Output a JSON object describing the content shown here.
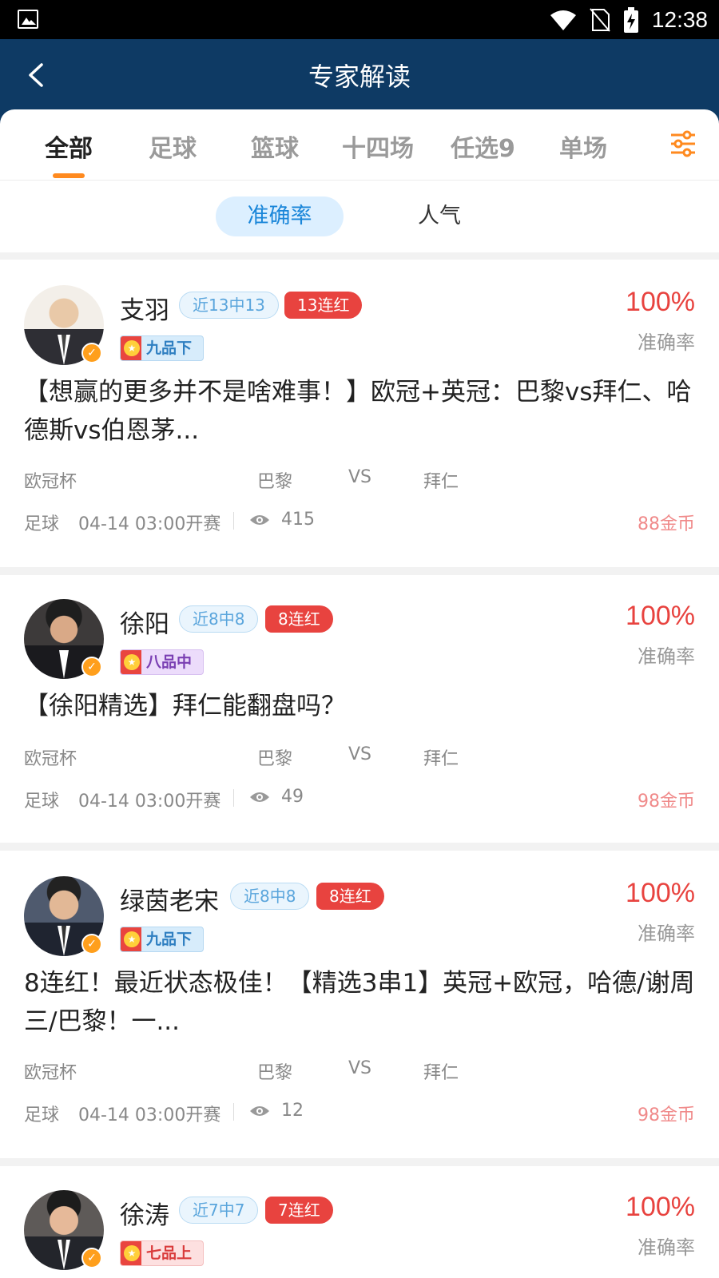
{
  "status_bar": {
    "time": "12:38"
  },
  "header": {
    "title": "专家解读"
  },
  "tabs": [
    {
      "label": "全部"
    },
    {
      "label": "足球"
    },
    {
      "label": "篮球"
    },
    {
      "label": "十四场"
    },
    {
      "label": "任选9"
    },
    {
      "label": "单场"
    }
  ],
  "subtabs": {
    "accuracy": "准确率",
    "popularity": "人气"
  },
  "cards": [
    {
      "name": "支羽",
      "recent": "近13中13",
      "streak": "13连红",
      "rank": "九品下",
      "accuracy": "100%",
      "accuracy_label": "准确率",
      "headline": "【想赢的更多并不是啥难事！】欧冠+英冠：巴黎vs拜仁、哈德斯vs伯恩茅...",
      "league": "欧冠杯",
      "home": "巴黎",
      "vs": "VS",
      "away": "拜仁",
      "sport": "足球",
      "kickoff": "04-14 03:00开赛",
      "views": "415",
      "price": "88金币"
    },
    {
      "name": "徐阳",
      "recent": "近8中8",
      "streak": "8连红",
      "rank": "八品中",
      "accuracy": "100%",
      "accuracy_label": "准确率",
      "headline": "【徐阳精选】拜仁能翻盘吗？",
      "league": "欧冠杯",
      "home": "巴黎",
      "vs": "VS",
      "away": "拜仁",
      "sport": "足球",
      "kickoff": "04-14 03:00开赛",
      "views": "49",
      "price": "98金币"
    },
    {
      "name": "绿茵老宋",
      "recent": "近8中8",
      "streak": "8连红",
      "rank": "九品下",
      "accuracy": "100%",
      "accuracy_label": "准确率",
      "headline": "8连红！最近状态极佳！【精选3串1】英冠+欧冠，哈德/谢周三/巴黎！一...",
      "league": "欧冠杯",
      "home": "巴黎",
      "vs": "VS",
      "away": "拜仁",
      "sport": "足球",
      "kickoff": "04-14 03:00开赛",
      "views": "12",
      "price": "98金币"
    },
    {
      "name": "徐涛",
      "recent": "近7中7",
      "streak": "7连红",
      "rank": "七品上",
      "accuracy": "100%",
      "accuracy_label": "准确率"
    }
  ]
}
